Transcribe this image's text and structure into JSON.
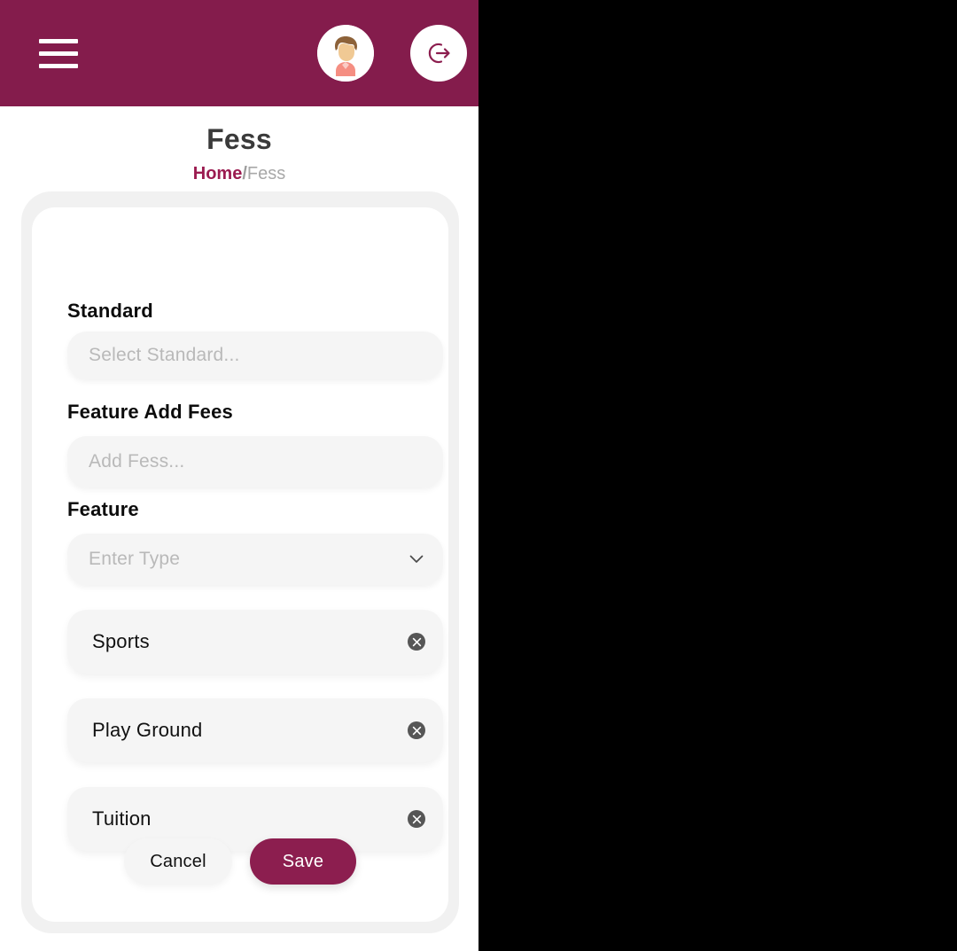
{
  "theme": {
    "brand_maroon": "#841C4C",
    "save_maroon": "#8C1E4F",
    "breadcrumb_link": "#9B1B50",
    "field_bg": "#F5F5F5",
    "outer_card_bg": "#F1F1F1",
    "chip_remove_bg": "#565656"
  },
  "header": {
    "menu_icon": "hamburger-menu-icon",
    "avatar_icon": "user-avatar-icon",
    "logout_icon": "logout-icon"
  },
  "page": {
    "title": "Fess",
    "breadcrumb": {
      "home": "Home",
      "separator": "/",
      "current": "Fess"
    }
  },
  "form": {
    "fields": [
      {
        "label": "Standard",
        "placeholder": "Select Standard...",
        "value": "",
        "type": "select",
        "has_chevron": false
      },
      {
        "label": "Feature Add Fees",
        "placeholder": "Add Fess...",
        "value": "",
        "type": "text",
        "has_chevron": false
      },
      {
        "label": "Feature",
        "placeholder": "Enter Type",
        "value": "",
        "type": "select",
        "has_chevron": true
      }
    ],
    "chips": [
      {
        "label": "Sports",
        "remove_icon": "close-circle-icon"
      },
      {
        "label": "Play Ground",
        "remove_icon": "close-circle-icon"
      },
      {
        "label": "Tuition",
        "remove_icon": "close-circle-icon"
      }
    ],
    "actions": {
      "cancel_label": "Cancel",
      "save_label": "Save"
    }
  }
}
